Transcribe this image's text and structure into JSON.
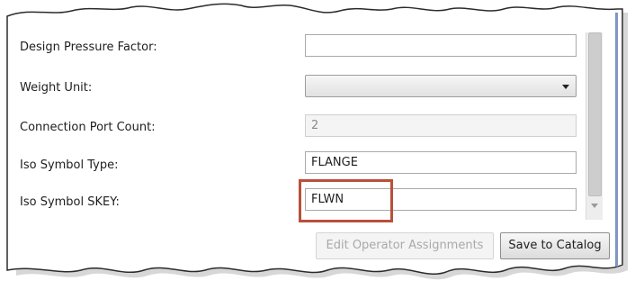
{
  "form": {
    "rows": [
      {
        "label": "Design Pressure Factor:",
        "value": "",
        "kind": "text"
      },
      {
        "label": "Weight Unit:",
        "value": "",
        "kind": "select"
      },
      {
        "label": "Connection Port Count:",
        "value": "2",
        "kind": "disabled"
      },
      {
        "label": "Iso Symbol Type:",
        "value": "FLANGE",
        "kind": "text"
      },
      {
        "label": "Iso Symbol SKEY:",
        "value": "FLWN",
        "kind": "text"
      }
    ]
  },
  "buttons": {
    "edit_operator_assignments": "Edit Operator Assignments",
    "save_to_catalog": "Save to Catalog"
  },
  "colors": {
    "highlight": "#b9503a",
    "panel_border": "#7f97c2"
  },
  "icons": {
    "dropdown": "chevron-down-icon"
  }
}
